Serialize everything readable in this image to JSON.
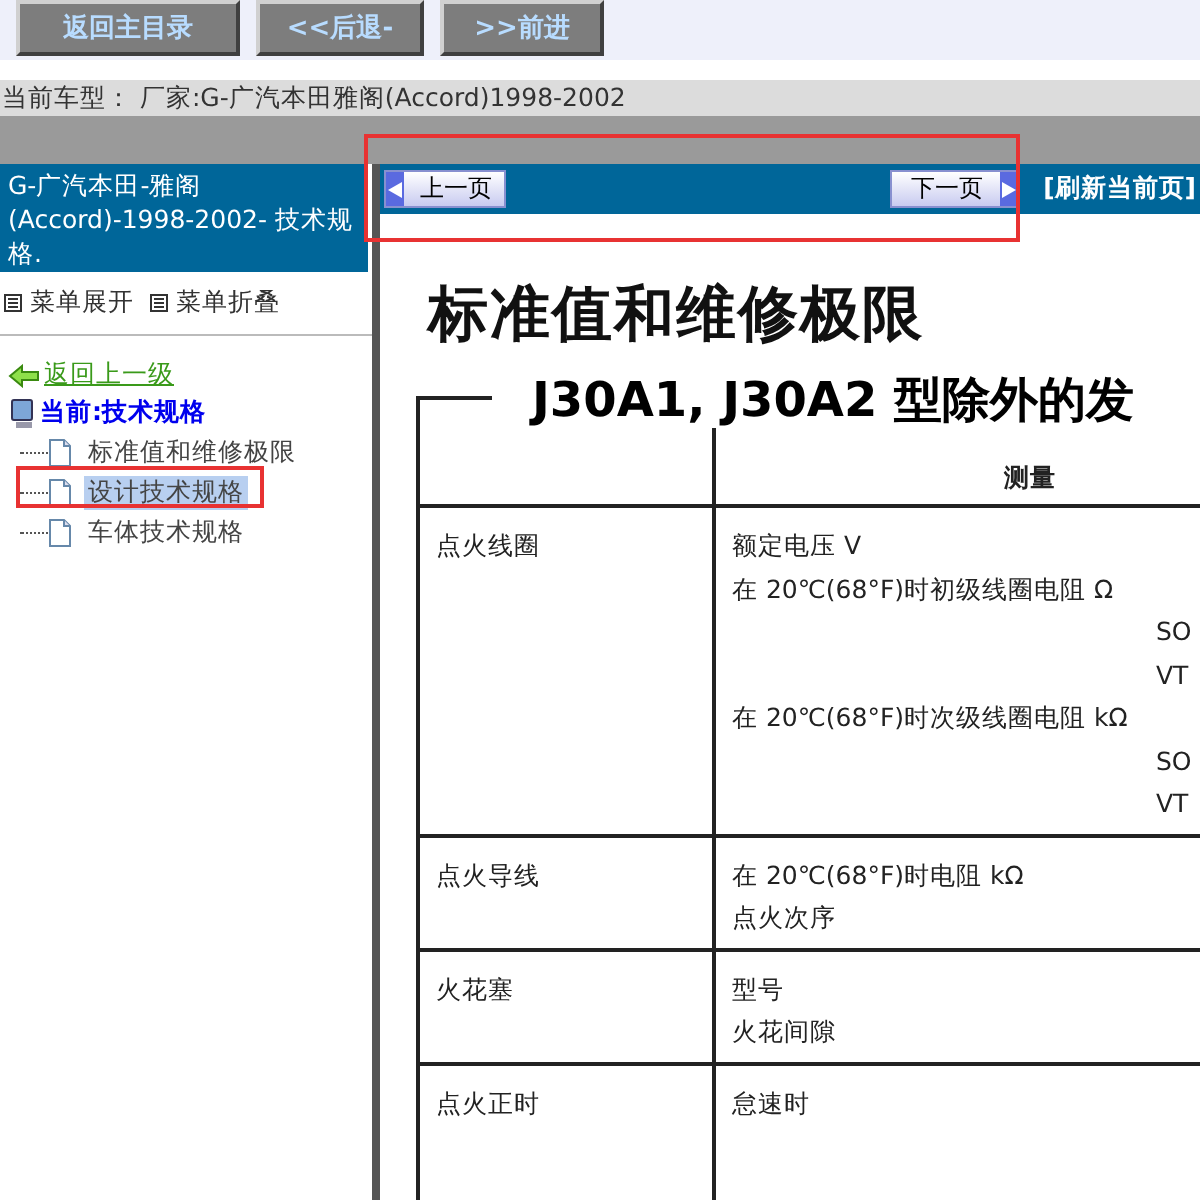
{
  "toolbar": {
    "buttons": [
      "返回主目录",
      "<<后退-",
      ">>前进"
    ]
  },
  "vehicle_line": "当前车型： 厂家:G-广汽本田雅阁(Accord)1998-2002",
  "sidebar": {
    "title": "G-广汽本田-雅阁(Accord)-1998-2002- 技术规格.",
    "menu_links": [
      "菜单展开",
      "菜单折叠"
    ],
    "back_link": "返回上一级",
    "current": "当前:技术规格",
    "items": [
      {
        "label": "标准值和维修极限",
        "selected": false
      },
      {
        "label": "设计技术规格",
        "selected": true
      },
      {
        "label": "车体技术规格",
        "selected": false
      }
    ]
  },
  "pager": {
    "prev": "上一页",
    "next": "下一页",
    "refresh": "[刷新当前页]"
  },
  "document": {
    "title": "标准值和维修极限",
    "subtitle": "J30A1, J30A2 型除外的发",
    "header": "测量",
    "rows": [
      {
        "item": "点火线圈",
        "lines": [
          {
            "text": "额定电压 V",
            "kind": "main"
          },
          {
            "text": "在 20℃(68°F)时初级线圈电阻 Ω",
            "kind": "main"
          },
          {
            "text": "SO",
            "kind": "sub"
          },
          {
            "text": "VT",
            "kind": "sub"
          },
          {
            "text": "在 20℃(68°F)时次级线圈电阻 kΩ",
            "kind": "main"
          },
          {
            "text": "SO",
            "kind": "sub"
          },
          {
            "text": "VT",
            "kind": "sub"
          }
        ]
      },
      {
        "item": "点火导线",
        "lines": [
          {
            "text": "在 20℃(68°F)时电阻 kΩ",
            "kind": "main"
          },
          {
            "text": "点火次序",
            "kind": "main"
          }
        ]
      },
      {
        "item": "火花塞",
        "lines": [
          {
            "text": "型号",
            "kind": "main"
          },
          {
            "text": "火花间隙",
            "kind": "main"
          }
        ]
      },
      {
        "item": "点火正时",
        "lines": [
          {
            "text": "怠速时",
            "kind": "main"
          }
        ]
      }
    ]
  }
}
